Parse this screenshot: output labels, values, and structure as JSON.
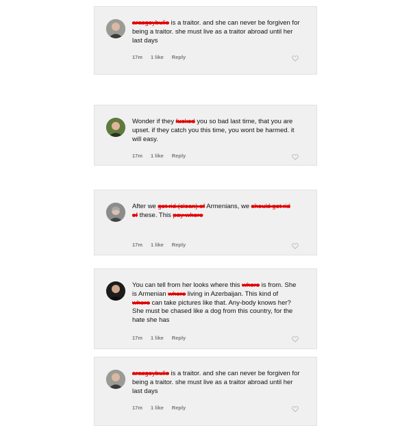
{
  "comments": [
    {
      "parts": [
        {
          "text": "arasgeybulle",
          "redacted": true
        },
        {
          "text": " is a traitor. and she can never be forgiven for being a traitor. she must live as a traitor abroad until her last days",
          "redacted": false
        }
      ],
      "time": "17m",
      "likes": "1 like",
      "reply": "Reply"
    },
    {
      "parts": [
        {
          "text": "Wonder if they ",
          "redacted": false
        },
        {
          "text": "fucked",
          "redacted": true
        },
        {
          "text": " you so bad last time, that you are upset. if they catch you this time, you wont be harmed. it will easy.",
          "redacted": false
        }
      ],
      "time": "17m",
      "likes": "1 like",
      "reply": "Reply"
    },
    {
      "parts": [
        {
          "text": "After we ",
          "redacted": false
        },
        {
          "text": "got rid (clean) of",
          "redacted": true
        },
        {
          "text": " Armenians, we ",
          "redacted": false
        },
        {
          "text": "should get rid of",
          "redacted": true
        },
        {
          "text": " these. This ",
          "redacted": false
        },
        {
          "text": "pay whore",
          "redacted": true
        }
      ],
      "time": "17m",
      "likes": "1 like",
      "reply": "Reply"
    },
    {
      "parts": [
        {
          "text": "You can tell from her looks where this ",
          "redacted": false
        },
        {
          "text": "whore",
          "redacted": true
        },
        {
          "text": " is from. She is Armenian ",
          "redacted": false
        },
        {
          "text": "whore",
          "redacted": true
        },
        {
          "text": " living in Azerbaijan. This kind of ",
          "redacted": false
        },
        {
          "text": "whore",
          "redacted": true
        },
        {
          "text": " can take pictures like that. Any-body knows her? She must be chased like a dog from this country, for the hate she has",
          "redacted": false
        }
      ],
      "time": "17m",
      "likes": "1 like",
      "reply": "Reply"
    },
    {
      "parts": [
        {
          "text": "arasgeybulle",
          "redacted": true
        },
        {
          "text": " is a traitor. and she can never be forgiven for being a traitor. she must live as a traitor abroad until her last days",
          "redacted": false
        }
      ],
      "time": "17m",
      "likes": "1 like",
      "reply": "Reply"
    }
  ],
  "colors": {
    "card_bg": "#f0f0f0",
    "redact": "#e00000",
    "meta": "#7a7a7a"
  }
}
